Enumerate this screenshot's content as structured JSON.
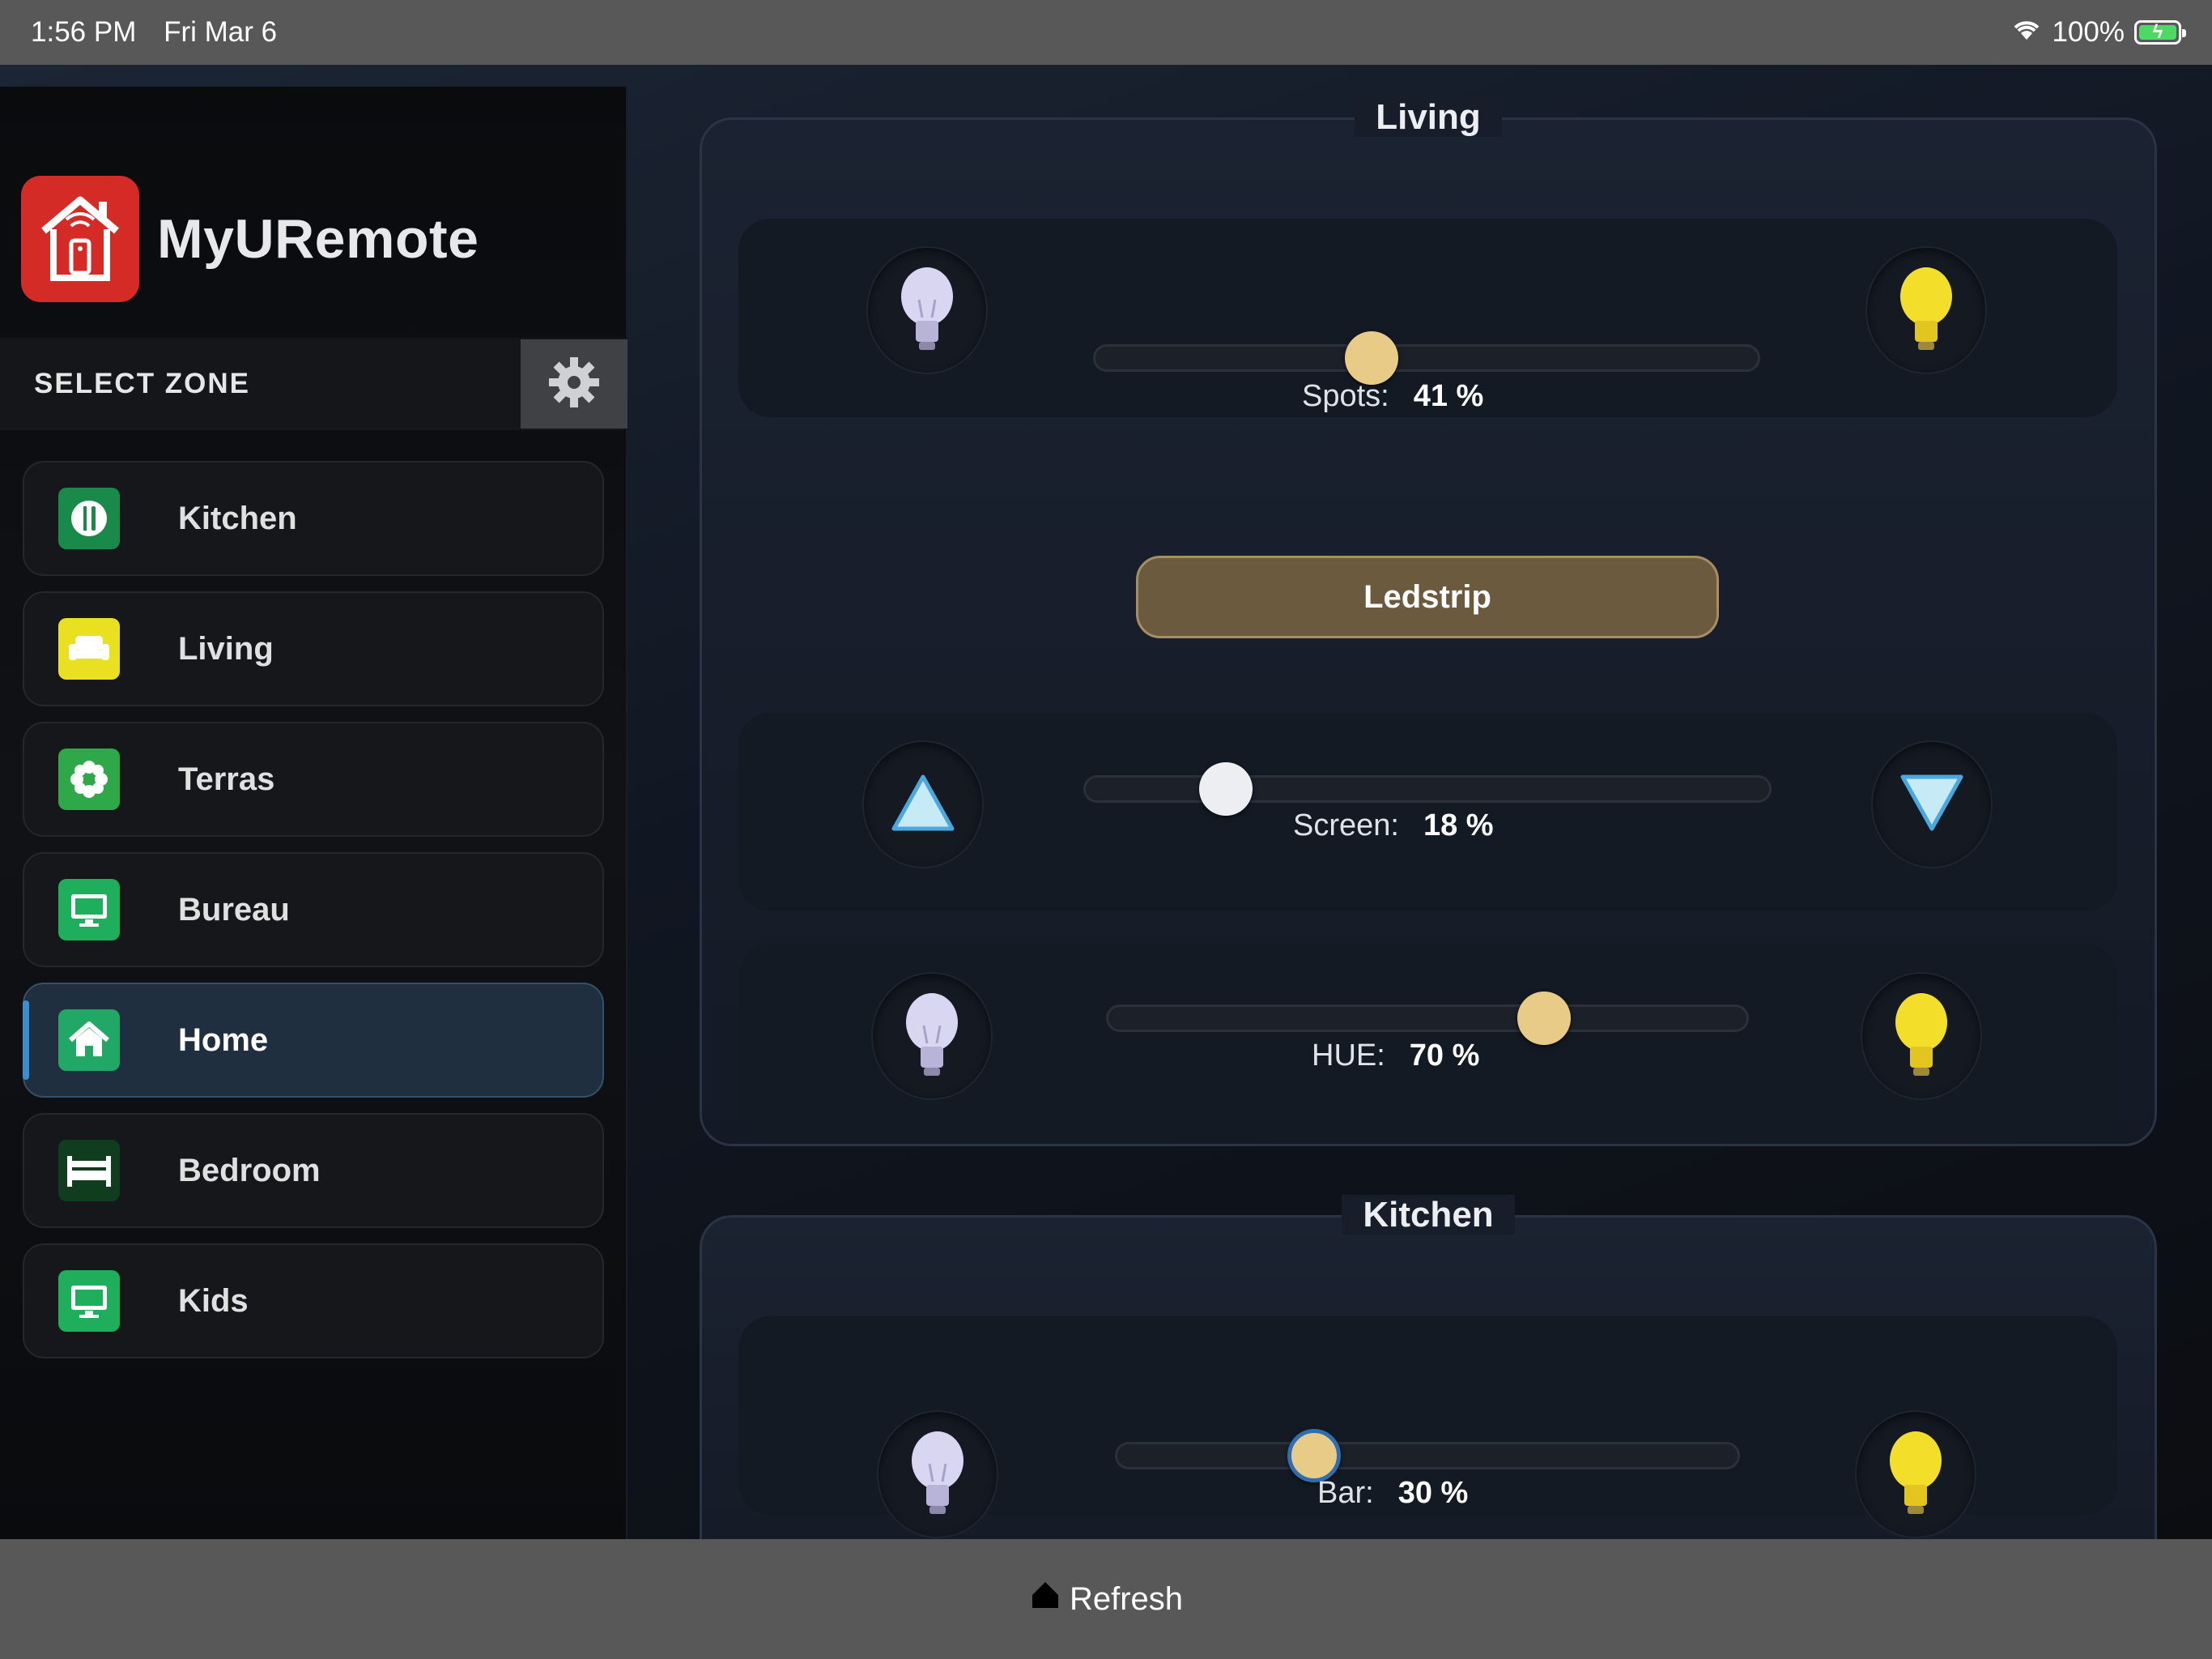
{
  "status_bar": {
    "time": "1:56 PM",
    "date": "Fri Mar 6",
    "battery": "100%"
  },
  "app": {
    "name": "MyURemote",
    "brand_color": "#d42b26"
  },
  "sidebar": {
    "select_zone_label": "SELECT ZONE",
    "items": [
      {
        "label": "Kitchen",
        "icon": "cutlery-icon",
        "color": "#1a8a4a"
      },
      {
        "label": "Living",
        "icon": "sofa-icon",
        "color": "#e8e020"
      },
      {
        "label": "Terras",
        "icon": "flower-icon",
        "color": "#2fa84a"
      },
      {
        "label": "Bureau",
        "icon": "monitor-icon",
        "color": "#1fae5c"
      },
      {
        "label": "Home",
        "icon": "home-icon",
        "color": "#22a866",
        "active": true
      },
      {
        "label": "Bedroom",
        "icon": "bed-icon",
        "color": "#0f3d1d"
      },
      {
        "label": "Kids",
        "icon": "monitor-icon",
        "color": "#1fae5c"
      }
    ]
  },
  "panels": {
    "living": {
      "title": "Living",
      "spots": {
        "label": "Spots:",
        "value": "41 %",
        "level": 41
      },
      "ledstrip_label": "Ledstrip",
      "screen": {
        "label": "Screen:",
        "value": "18 %",
        "level": 18
      },
      "hue": {
        "label": "HUE:",
        "value": "70 %",
        "level": 70
      }
    },
    "kitchen": {
      "title": "Kitchen",
      "bar": {
        "label": "Bar:",
        "value": "30 %",
        "level": 30
      }
    }
  },
  "bottom_bar": {
    "refresh_label": "Refresh"
  }
}
